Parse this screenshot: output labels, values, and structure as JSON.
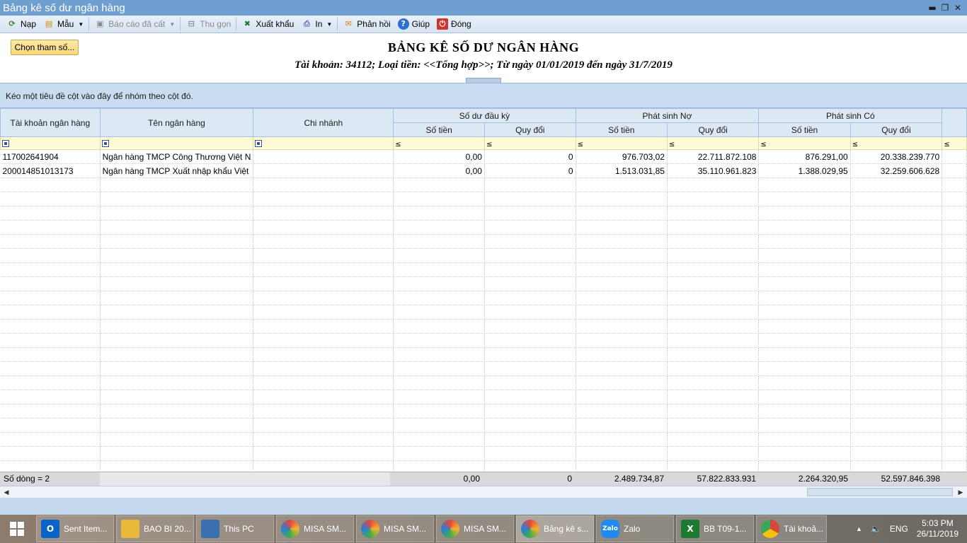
{
  "window": {
    "title": "Bảng kê số dư ngân hàng",
    "minimize_icon": "minimize-icon",
    "restore_icon": "restore-icon",
    "close_icon": "close-icon"
  },
  "toolbar": {
    "items": [
      {
        "label": "Nạp",
        "icon": "refresh-icon",
        "color": "#2a8a2a"
      },
      {
        "label": "Mẫu",
        "icon": "template-icon",
        "color": "#d08a00"
      },
      {
        "label": "Báo cáo đã cất",
        "icon": "saved-report-icon",
        "color": "#888888"
      },
      {
        "label": "Thu gọn",
        "icon": "collapse-icon",
        "color": "#888888"
      },
      {
        "label": "Xuất khẩu",
        "icon": "excel-export-icon",
        "color": "#1e7a30"
      },
      {
        "label": "In",
        "icon": "printer-icon",
        "color": "#6b6bb5"
      },
      {
        "label": "Phản hồi",
        "icon": "feedback-mail-icon",
        "color": "#e07a1a"
      },
      {
        "label": "Giúp",
        "icon": "help-icon",
        "color": "#2b6fd1"
      },
      {
        "label": "Đóng",
        "icon": "power-close-icon",
        "color": "#d0342c"
      }
    ]
  },
  "params_button": "Chọn tham số...",
  "report": {
    "title": "BẢNG KÊ SỐ DƯ NGÂN HÀNG",
    "subtitle": "Tài khoản: 34112; Loại tiền: <<Tổng hợp>>; Từ ngày 01/01/2019 đến ngày 31/7/2019"
  },
  "group_panel_text": "Kéo một tiêu đề cột vào đây để nhóm theo cột đó.",
  "grid": {
    "headers": {
      "account": "Tài khoản ngân hàng",
      "bank_name": "Tên ngân hàng",
      "branch": "Chi nhánh",
      "opening": "Số dư đầu kỳ",
      "debit": "Phát sinh Nợ",
      "credit": "Phát sinh Có",
      "amount": "Số tiền",
      "converted": "Quy đổi"
    },
    "filter_symbol": "≤",
    "rows": [
      {
        "account": "117002641904",
        "bank_name": "Ngân hàng TMCP Công Thương Việt N",
        "branch": "",
        "open_amount": "0,00",
        "open_conv": "0",
        "debit_amount": "976.703,02",
        "debit_conv": "22.711.872.108",
        "credit_amount": "876.291,00",
        "credit_conv": "20.338.239.770"
      },
      {
        "account": "200014851013173",
        "bank_name": "Ngân hàng TMCP Xuất nhập khẩu Việt",
        "branch": "",
        "open_amount": "0,00",
        "open_conv": "0",
        "debit_amount": "1.513.031,85",
        "debit_conv": "35.110.961.823",
        "credit_amount": "1.388.029,95",
        "credit_conv": "32.259.606.628"
      }
    ],
    "footer": {
      "row_count": "Số dòng = 2",
      "open_amount": "0,00",
      "open_conv": "0",
      "debit_amount": "2.489.734,87",
      "debit_conv": "57.822.833.931",
      "credit_amount": "2.264.320,95",
      "credit_conv": "52.597.846.398"
    }
  },
  "taskbar": {
    "items": [
      {
        "label": "Sent Item...",
        "icon": "outlook-icon",
        "color": "#0a64c8",
        "glyph": "O"
      },
      {
        "label": "BAO BI 20...",
        "icon": "folder-icon",
        "color": "#e8b93a",
        "glyph": ""
      },
      {
        "label": "This PC",
        "icon": "computer-icon",
        "color": "#3b6fb0",
        "glyph": ""
      },
      {
        "label": "MISA SM...",
        "icon": "misa-icon",
        "color": "#e3483b",
        "glyph": ""
      },
      {
        "label": "MISA SM...",
        "icon": "misa-icon",
        "color": "#e3483b",
        "glyph": ""
      },
      {
        "label": "MISA SM...",
        "icon": "misa-icon",
        "color": "#e3483b",
        "glyph": ""
      },
      {
        "label": "Bảng kê s...",
        "icon": "misa-icon",
        "color": "#e3483b",
        "glyph": ""
      },
      {
        "label": "Zalo",
        "icon": "zalo-icon",
        "color": "#1f8af0",
        "glyph": "Zalo"
      },
      {
        "label": "BB T09-1...",
        "icon": "excel-icon",
        "color": "#1e7a30",
        "glyph": "X"
      },
      {
        "label": "Tài khoả...",
        "icon": "chrome-icon",
        "color": "#d9463a",
        "glyph": ""
      }
    ],
    "tray": {
      "language": "ENG",
      "time": "5:03 PM",
      "date": "26/11/2019"
    }
  }
}
